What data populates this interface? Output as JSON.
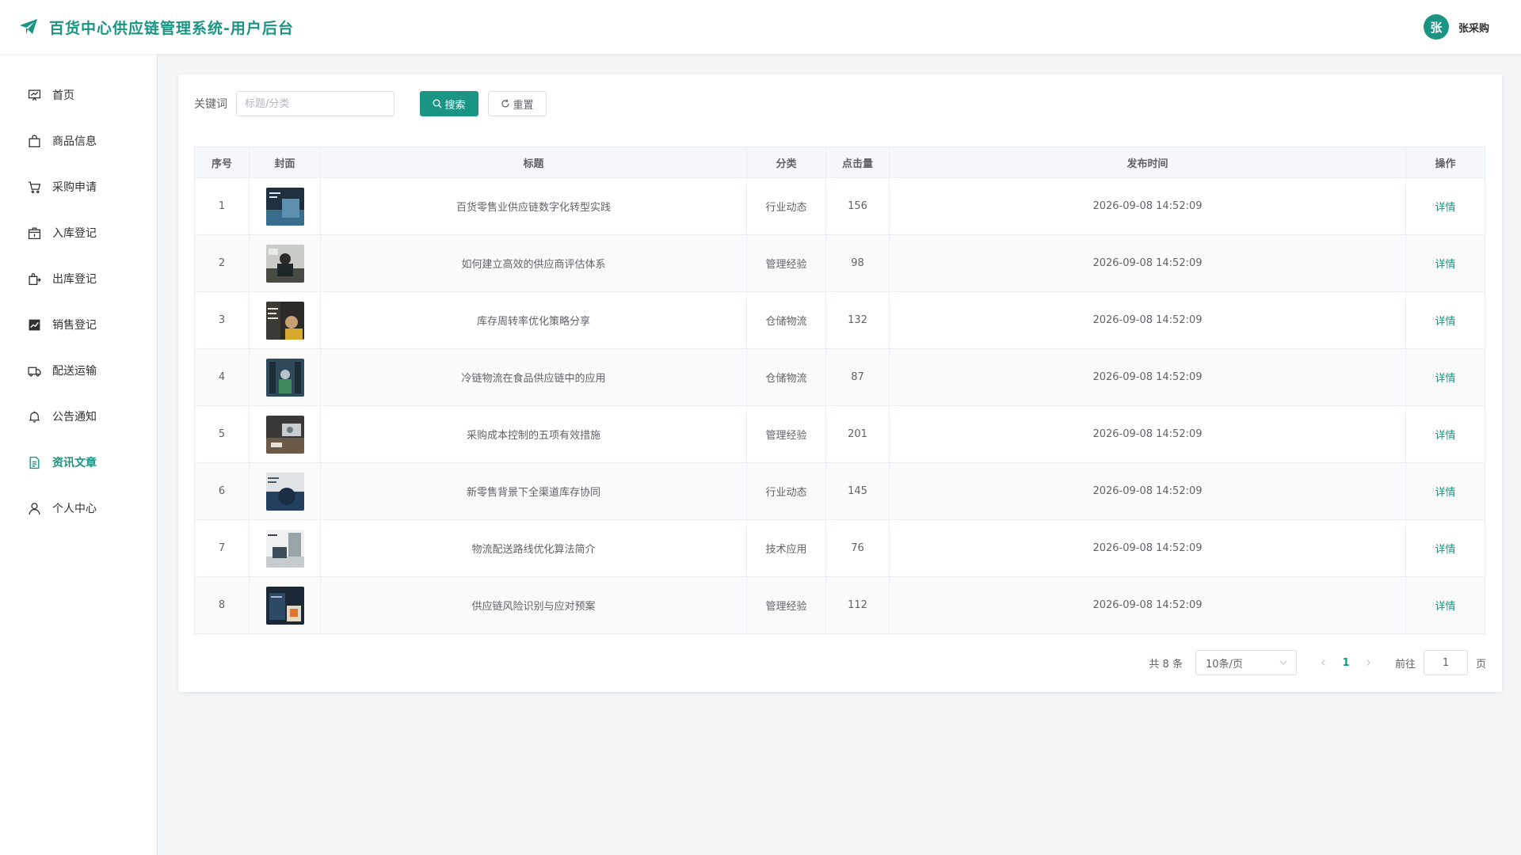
{
  "header": {
    "title": "百货中心供应链管理系统-用户后台",
    "avatar_text": "张",
    "user_name": "张采购"
  },
  "sidebar": {
    "items": [
      {
        "label": "首页",
        "icon": "dashboard-icon"
      },
      {
        "label": "商品信息",
        "icon": "shopping-bag-icon"
      },
      {
        "label": "采购申请",
        "icon": "cart-icon"
      },
      {
        "label": "入库登记",
        "icon": "box-in-icon"
      },
      {
        "label": "出库登记",
        "icon": "box-out-icon"
      },
      {
        "label": "销售登记",
        "icon": "trend-chart-icon"
      },
      {
        "label": "配送运输",
        "icon": "truck-icon"
      },
      {
        "label": "公告通知",
        "icon": "bell-icon"
      },
      {
        "label": "资讯文章",
        "icon": "document-icon",
        "active": true
      },
      {
        "label": "个人中心",
        "icon": "user-icon"
      }
    ]
  },
  "filter": {
    "keyword_label": "关键词",
    "keyword_placeholder": "标题/分类",
    "keyword_value": "",
    "search_label": "搜索",
    "reset_label": "重置"
  },
  "table": {
    "columns": [
      "序号",
      "封面",
      "标题",
      "分类",
      "点击量",
      "发布时间",
      "操作"
    ],
    "action_label": "详情",
    "rows": [
      {
        "index": "1",
        "title": "百货零售业供应链数字化转型实践",
        "category": "行业动态",
        "clicks": "156",
        "time": "2026-09-08 14:52:09"
      },
      {
        "index": "2",
        "title": "如何建立高效的供应商评估体系",
        "category": "管理经验",
        "clicks": "98",
        "time": "2026-09-08 14:52:09"
      },
      {
        "index": "3",
        "title": "库存周转率优化策略分享",
        "category": "仓储物流",
        "clicks": "132",
        "time": "2026-09-08 14:52:09"
      },
      {
        "index": "4",
        "title": "冷链物流在食品供应链中的应用",
        "category": "仓储物流",
        "clicks": "87",
        "time": "2026-09-08 14:52:09"
      },
      {
        "index": "5",
        "title": "采购成本控制的五项有效措施",
        "category": "管理经验",
        "clicks": "201",
        "time": "2026-09-08 14:52:09"
      },
      {
        "index": "6",
        "title": "新零售背景下全渠道库存协同",
        "category": "行业动态",
        "clicks": "145",
        "time": "2026-09-08 14:52:09"
      },
      {
        "index": "7",
        "title": "物流配送路线优化算法简介",
        "category": "技术应用",
        "clicks": "76",
        "time": "2026-09-08 14:52:09"
      },
      {
        "index": "8",
        "title": "供应链风险识别与应对预案",
        "category": "管理经验",
        "clicks": "112",
        "time": "2026-09-08 14:52:09"
      }
    ]
  },
  "pagination": {
    "total_text": "共 8 条",
    "page_size": "10条/页",
    "current_page": "1",
    "goto_label": "前往",
    "goto_value": "1",
    "page_suffix": "页"
  },
  "colors": {
    "primary": "#1a9583",
    "text": "#606266",
    "border": "#ebeef5"
  }
}
